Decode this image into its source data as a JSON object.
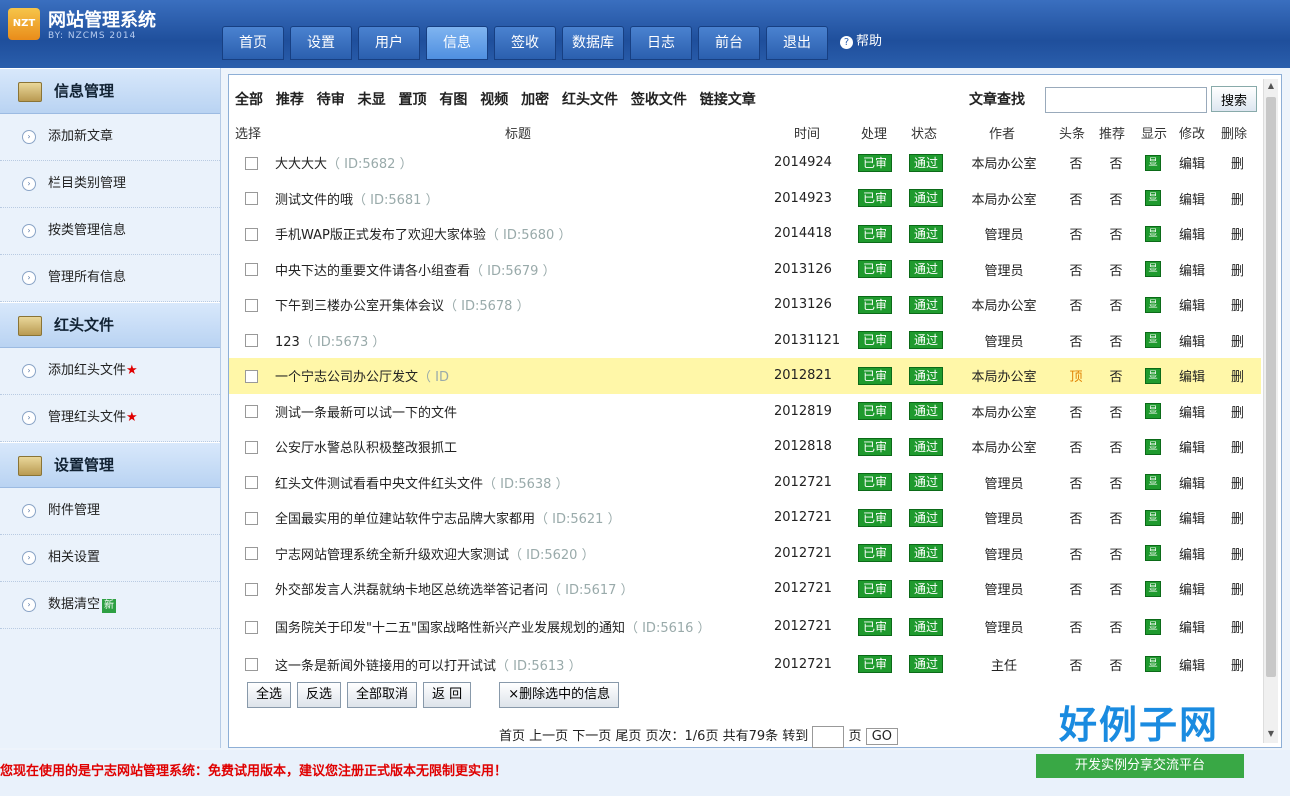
{
  "app": {
    "title": "网站管理系统",
    "subtitle": "BY: NZCMS 2014",
    "logo_text": "NZT"
  },
  "nav": {
    "items": [
      {
        "label": "首页",
        "active": false
      },
      {
        "label": "设置",
        "active": false
      },
      {
        "label": "用户",
        "active": false
      },
      {
        "label": "信息",
        "active": true
      },
      {
        "label": "签收",
        "active": false
      },
      {
        "label": "数据库",
        "active": false
      },
      {
        "label": "日志",
        "active": false
      },
      {
        "label": "前台",
        "active": false
      },
      {
        "label": "退出",
        "active": false
      }
    ],
    "help_label": "帮助"
  },
  "sidebar": {
    "section1": {
      "title": "信息管理",
      "items": [
        "添加新文章",
        "栏目类别管理",
        "按类管理信息",
        "管理所有信息"
      ]
    },
    "section2": {
      "title": "红头文件",
      "items": [
        "添加红头文件",
        "管理红头文件"
      ]
    },
    "section3": {
      "title": "设置管理",
      "items": [
        "附件管理",
        "相关设置",
        "数据清空"
      ]
    },
    "star": "★",
    "new_badge": "新"
  },
  "filters": [
    "全部",
    "推荐",
    "待审",
    "未显",
    "置顶",
    "有图",
    "视频",
    "加密",
    "红头文件",
    "签收文件",
    "链接文章"
  ],
  "search": {
    "label": "文章查找",
    "button": "搜索",
    "value": ""
  },
  "table": {
    "headers": [
      "选择",
      "标题",
      "时间",
      "处理",
      "状态",
      "作者",
      "头条",
      "推荐",
      "显示",
      "修改",
      "删除"
    ],
    "rows": [
      {
        "title": "大大大大",
        "id": "（ ID:5682 ）",
        "date": "2014924",
        "proc": "已审",
        "state": "通过",
        "author": "本局办公室",
        "head": "否",
        "rec": "否",
        "show": "显",
        "edit": "编辑",
        "del": "删"
      },
      {
        "title": "测试文件的哦",
        "id": "（ ID:5681 ）",
        "date": "2014923",
        "proc": "已审",
        "state": "通过",
        "author": "本局办公室",
        "head": "否",
        "rec": "否",
        "show": "显",
        "edit": "编辑",
        "del": "删"
      },
      {
        "title": "手机WAP版正式发布了欢迎大家体验",
        "id": "（ ID:5680 ）",
        "date": "2014418",
        "proc": "已审",
        "state": "通过",
        "author": "管理员",
        "head": "否",
        "rec": "否",
        "show": "显",
        "edit": "编辑",
        "del": "删"
      },
      {
        "title": "中央下达的重要文件请各小组查看",
        "id": "（ ID:5679 ）",
        "date": "2013126",
        "proc": "已审",
        "state": "通过",
        "author": "管理员",
        "head": "否",
        "rec": "否",
        "show": "显",
        "edit": "编辑",
        "del": "删"
      },
      {
        "title": "下午到三楼办公室开集体会议",
        "id": "（ ID:5678 ）",
        "date": "2013126",
        "proc": "已审",
        "state": "通过",
        "author": "本局办公室",
        "head": "否",
        "rec": "否",
        "show": "显",
        "edit": "编辑",
        "del": "删"
      },
      {
        "title": "123",
        "id": "（ ID:5673 ）",
        "date": "20131121",
        "proc": "已审",
        "state": "通过",
        "author": "管理员",
        "head": "否",
        "rec": "否",
        "show": "显",
        "edit": "编辑",
        "del": "删"
      },
      {
        "title": "一个宁志公司办公厅发文",
        "id": "（ ID",
        "date": "2012821",
        "proc": "已审",
        "state": "通过",
        "author": "本局办公室",
        "head": "顶",
        "rec": "否",
        "show": "显",
        "edit": "编辑",
        "del": "删"
      },
      {
        "title": "测试一条最新可以试一下的文件",
        "id": "",
        "date": "2012819",
        "proc": "已审",
        "state": "通过",
        "author": "本局办公室",
        "head": "否",
        "rec": "否",
        "show": "显",
        "edit": "编辑",
        "del": "删"
      },
      {
        "title": "公安厅水警总队积极整改狠抓工",
        "id": "",
        "date": "2012818",
        "proc": "已审",
        "state": "通过",
        "author": "本局办公室",
        "head": "否",
        "rec": "否",
        "show": "显",
        "edit": "编辑",
        "del": "删"
      },
      {
        "title": "红头文件测试看看中央文件红头文件",
        "id": "（ ID:5638 ）",
        "date": "2012721",
        "proc": "已审",
        "state": "通过",
        "author": "管理员",
        "head": "否",
        "rec": "否",
        "show": "显",
        "edit": "编辑",
        "del": "删"
      },
      {
        "title": "全国最实用的单位建站软件宁志品牌大家都用",
        "id": "（ ID:5621 ）",
        "date": "2012721",
        "proc": "已审",
        "state": "通过",
        "author": "管理员",
        "head": "否",
        "rec": "否",
        "show": "显",
        "edit": "编辑",
        "del": "删"
      },
      {
        "title": "宁志网站管理系统全新升级欢迎大家测试",
        "id": "（ ID:5620 ）",
        "date": "2012721",
        "proc": "已审",
        "state": "通过",
        "author": "管理员",
        "head": "否",
        "rec": "否",
        "show": "显",
        "edit": "编辑",
        "del": "删"
      },
      {
        "title": "外交部发言人洪磊就纳卡地区总统选举答记者问",
        "id": "（ ID:5617 ）",
        "date": "2012721",
        "proc": "已审",
        "state": "通过",
        "author": "管理员",
        "head": "否",
        "rec": "否",
        "show": "显",
        "edit": "编辑",
        "del": "删"
      },
      {
        "title": "国务院关于印发\"十二五\"国家战略性新兴产业发展规划的通知",
        "id": "（ ID:5616 ）",
        "date": "2012721",
        "proc": "已审",
        "state": "通过",
        "author": "管理员",
        "head": "否",
        "rec": "否",
        "show": "显",
        "edit": "编辑",
        "del": "删"
      },
      {
        "title": "这一条是新闻外链接用的可以打开试试",
        "id": "（ ID:5613 ）",
        "date": "2012721",
        "proc": "已审",
        "state": "通过",
        "author": "主任",
        "head": "否",
        "rec": "否",
        "show": "显",
        "edit": "编辑",
        "del": "删"
      }
    ]
  },
  "actions": {
    "select_all": "全选",
    "invert": "反选",
    "cancel_all": "全部取消",
    "back": "返 回",
    "delete_selected": "×删除选中的信息"
  },
  "pager": {
    "text": "首页 上一页 下一页 尾页 页次：1/6页 共有79条 转到",
    "page_suffix": "页",
    "go": "GO"
  },
  "footer": {
    "notice": "您现在使用的是宁志网站管理系统：免费试用版本，建议您注册正式版本无限制更实用！"
  },
  "watermark": {
    "brand": "好例子网",
    "slogan": "开发实例分享交流平台"
  },
  "colors": {
    "accent": "#2b5fae",
    "pass_green": "#1f9a2e",
    "highlight": "#fff7a8",
    "alert_red": "#e00000"
  }
}
